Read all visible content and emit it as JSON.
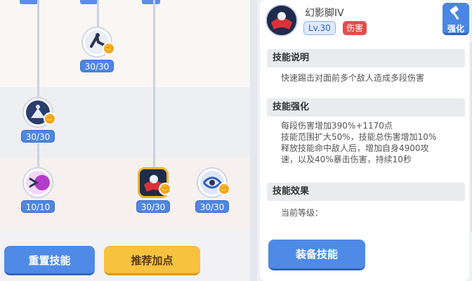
{
  "tree": {
    "nodes": [
      {
        "id": "kick-sweep",
        "level": "30/30",
        "icon": "kick-skill-icon"
      },
      {
        "id": "shadow-strike",
        "level": "30/30",
        "icon": "shadow-strike-skill-icon"
      },
      {
        "id": "purple-burst",
        "level": "10/10",
        "icon": "purple-burst-skill-icon"
      },
      {
        "id": "phantom-kick-iv",
        "level": "30/30",
        "icon": "phantom-kick-skill-icon",
        "selected": true
      },
      {
        "id": "whirl-kick",
        "level": "30/30",
        "icon": "whirl-kick-skill-icon"
      }
    ],
    "reset_label": "重置技能",
    "recommend_label": "推荐加点"
  },
  "detail": {
    "skill_name": "幻影脚IV",
    "level_badge": "Lv.30",
    "type_badge": "伤害",
    "upgrade_label": "强化",
    "sections": {
      "description_title": "技能说明",
      "description_text": "快速踢击对面前多个敌人造成多段伤害",
      "enhance_title": "技能强化",
      "enhance_lines": [
        "每段伤害增加390%+1170点",
        "技能范围扩大50%，技能总伤害增加10%",
        "释放技能命中敌人后，增加自身4900攻",
        "速，以及40%暴击伤害，持续10秒"
      ],
      "effect_title": "技能效果",
      "current_level_label": "当前等级："
    },
    "equip_label": "装备技能"
  },
  "colors": {
    "accent_blue": "#4f8ae6",
    "accent_yellow": "#f7c23e",
    "damage_red": "#e24d4d",
    "selected_gold": "#f0b429"
  }
}
